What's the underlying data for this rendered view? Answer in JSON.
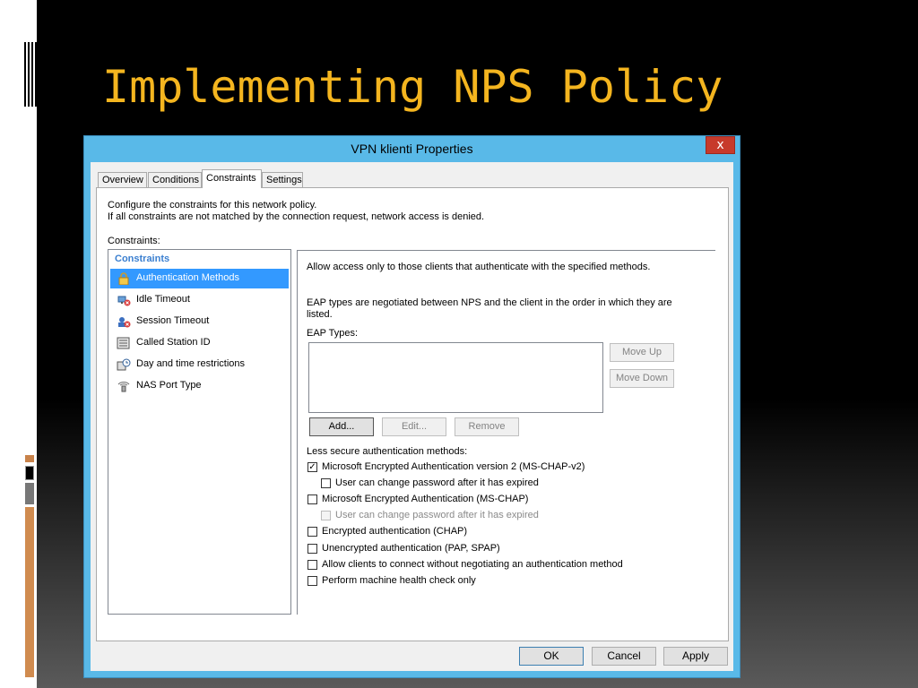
{
  "slide": {
    "title": "Implementing NPS Policy"
  },
  "colors": {
    "title": "#f4b51f",
    "dialog_frame": "#59b9e8",
    "selection": "#3399ff",
    "close": "#c73a2b"
  },
  "dialog": {
    "title": "VPN klienti Properties",
    "close_glyph": "x",
    "tabs": [
      {
        "label": "Overview",
        "active": false
      },
      {
        "label": "Conditions",
        "active": false
      },
      {
        "label": "Constraints",
        "active": true
      },
      {
        "label": "Settings",
        "active": false
      }
    ],
    "description_line1": "Configure the constraints for this network policy.",
    "description_line2": "If all constraints are not matched by the connection request, network access is denied.",
    "constraints_label": "Constraints:",
    "list_header": "Constraints",
    "constraints": [
      {
        "label": "Authentication Methods",
        "icon": "lock-icon",
        "selected": true
      },
      {
        "label": "Idle Timeout",
        "icon": "idle-timeout-icon",
        "selected": false
      },
      {
        "label": "Session Timeout",
        "icon": "session-timeout-icon",
        "selected": false
      },
      {
        "label": "Called Station ID",
        "icon": "station-id-icon",
        "selected": false
      },
      {
        "label": "Day and time restrictions",
        "icon": "calendar-clock-icon",
        "selected": false
      },
      {
        "label": "NAS Port Type",
        "icon": "antenna-icon",
        "selected": false
      }
    ],
    "detail": {
      "intro": "Allow access only to those clients that authenticate with the specified methods.",
      "eap_note_line1": "EAP types are negotiated between NPS and the client in the order in which they are",
      "eap_note_line2": "listed.",
      "eap_types_label": "EAP Types:",
      "move_up": "Move Up",
      "move_down": "Move Down",
      "add": "Add...",
      "edit": "Edit...",
      "remove": "Remove",
      "less_secure_label": "Less secure authentication methods:",
      "options": [
        {
          "label": "Microsoft Encrypted Authentication version 2 (MS-CHAP-v2)",
          "checked": true,
          "disabled": false,
          "indent": false
        },
        {
          "label": "User can change password after it has expired",
          "checked": false,
          "disabled": false,
          "indent": true
        },
        {
          "label": "Microsoft Encrypted Authentication (MS-CHAP)",
          "checked": false,
          "disabled": false,
          "indent": false
        },
        {
          "label": "User can change password after it has expired",
          "checked": false,
          "disabled": true,
          "indent": true
        },
        {
          "label": "Encrypted authentication (CHAP)",
          "checked": false,
          "disabled": false,
          "indent": false
        },
        {
          "label": "Unencrypted authentication (PAP, SPAP)",
          "checked": false,
          "disabled": false,
          "indent": false
        },
        {
          "label": "Allow clients to connect without negotiating an authentication method",
          "checked": false,
          "disabled": false,
          "indent": false
        },
        {
          "label": "Perform machine health check only",
          "checked": false,
          "disabled": false,
          "indent": false
        }
      ]
    },
    "footer": {
      "ok": "OK",
      "cancel": "Cancel",
      "apply": "Apply"
    }
  }
}
